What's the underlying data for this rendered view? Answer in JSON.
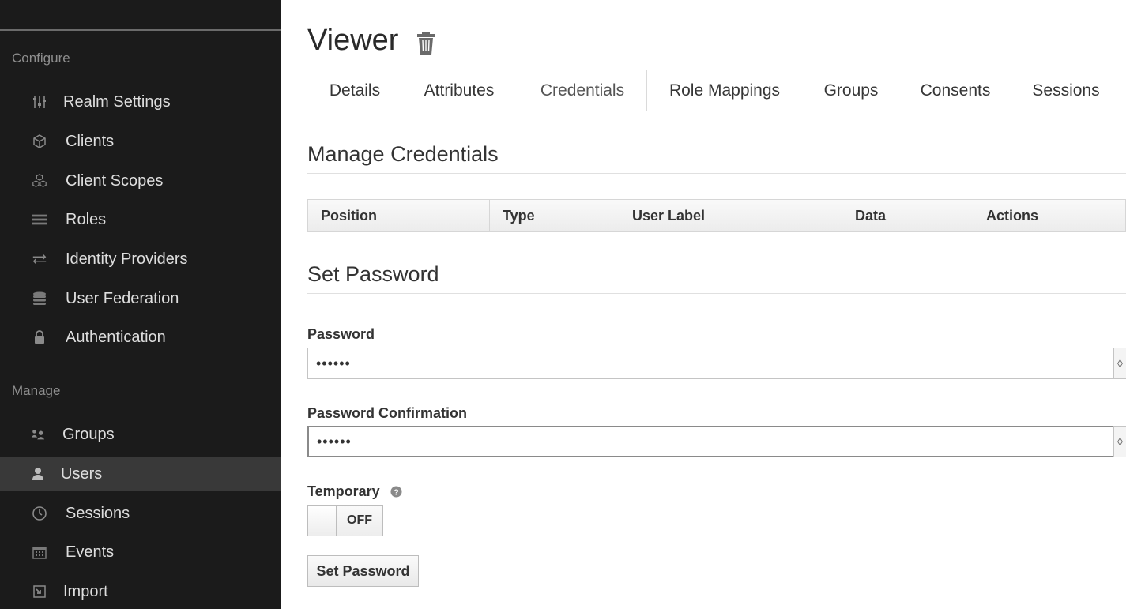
{
  "sidebar": {
    "configure_label": "Configure",
    "manage_label": "Manage",
    "configure_items": [
      {
        "label": "Realm Settings",
        "icon": "sliders-icon"
      },
      {
        "label": "Clients",
        "icon": "cube-icon"
      },
      {
        "label": "Client Scopes",
        "icon": "cubes-icon"
      },
      {
        "label": "Roles",
        "icon": "list-icon"
      },
      {
        "label": "Identity Providers",
        "icon": "exchange-icon"
      },
      {
        "label": "User Federation",
        "icon": "database-icon"
      },
      {
        "label": "Authentication",
        "icon": "lock-icon"
      }
    ],
    "manage_items": [
      {
        "label": "Groups",
        "icon": "users-icon"
      },
      {
        "label": "Users",
        "icon": "user-icon",
        "active": true
      },
      {
        "label": "Sessions",
        "icon": "clock-icon"
      },
      {
        "label": "Events",
        "icon": "calendar-icon"
      },
      {
        "label": "Import",
        "icon": "import-icon"
      }
    ]
  },
  "header": {
    "title": "Viewer"
  },
  "tabs": [
    {
      "label": "Details"
    },
    {
      "label": "Attributes"
    },
    {
      "label": "Credentials",
      "active": true
    },
    {
      "label": "Role Mappings"
    },
    {
      "label": "Groups"
    },
    {
      "label": "Consents"
    },
    {
      "label": "Sessions"
    }
  ],
  "manage_credentials": {
    "heading": "Manage Credentials",
    "columns": [
      "Position",
      "Type",
      "User Label",
      "Data",
      "Actions"
    ]
  },
  "set_password": {
    "heading": "Set Password",
    "password_label": "Password",
    "password_value": "••••••",
    "confirm_label": "Password Confirmation",
    "confirm_value": "••••••",
    "temporary_label": "Temporary",
    "temporary_state": "OFF",
    "submit_label": "Set Password"
  },
  "colors": {
    "sidebar_bg": "#1b1b1b",
    "sidebar_active_bg": "#393939"
  }
}
